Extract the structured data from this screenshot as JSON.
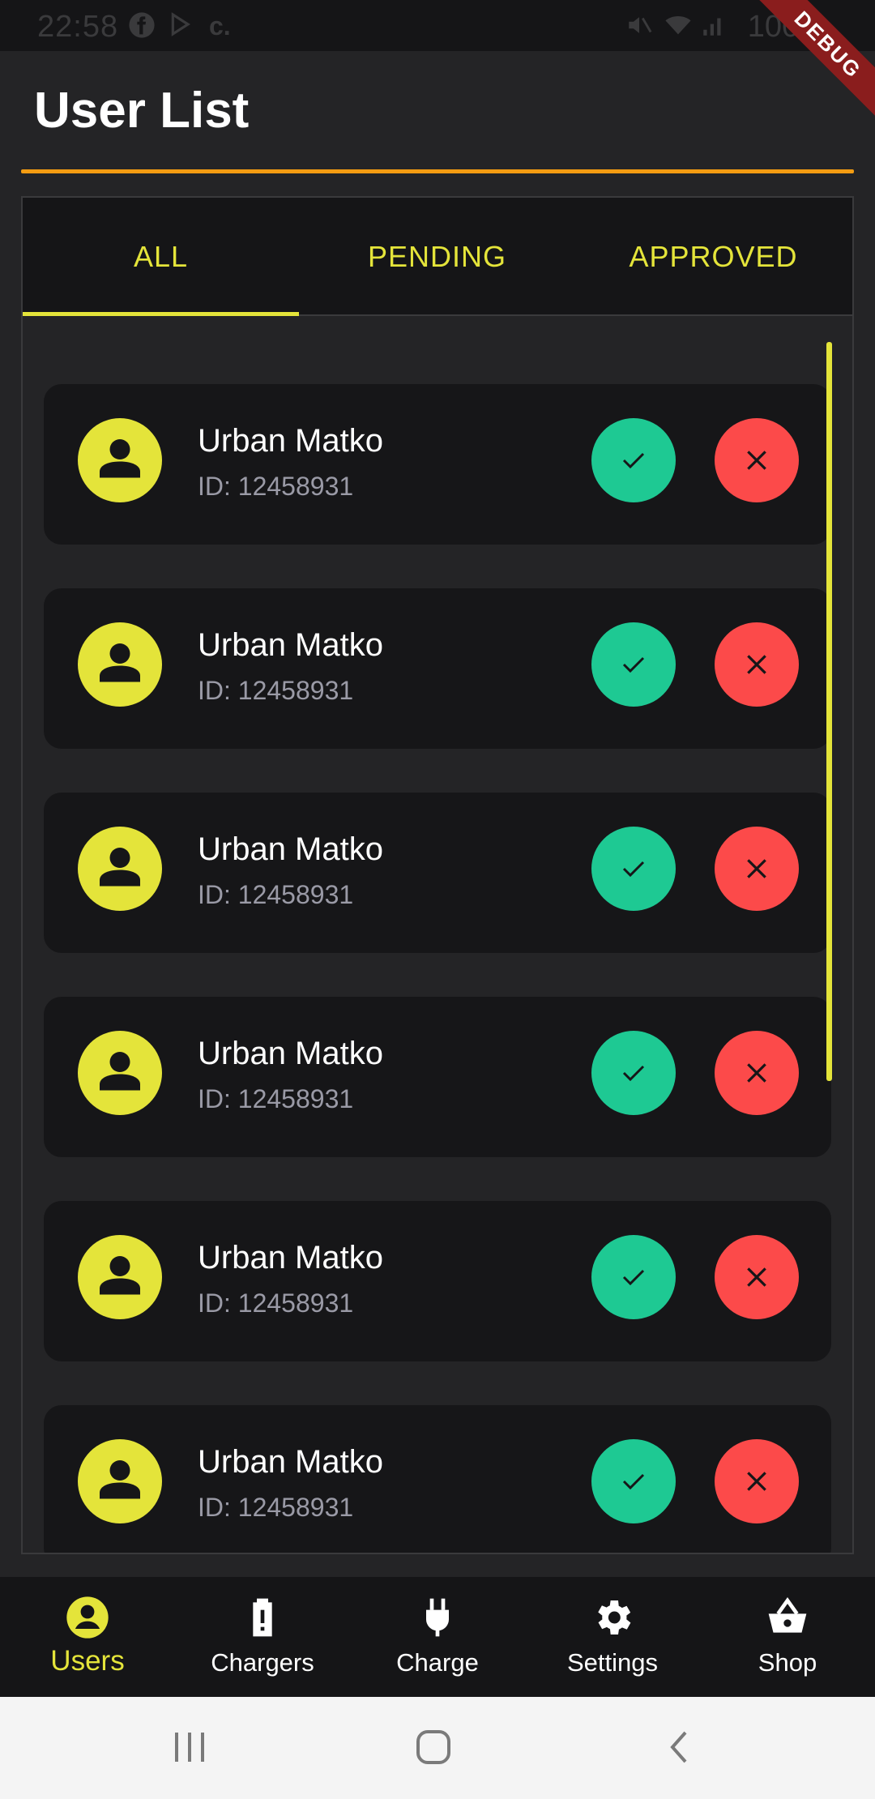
{
  "status_bar": {
    "time": "22:58",
    "battery": "100%",
    "icons": [
      "facebook-icon",
      "play-store-icon",
      "c-icon",
      "mute-icon",
      "wifi-icon",
      "signal-icon",
      "battery-icon"
    ]
  },
  "debug_banner": "DEBUG",
  "app_bar": {
    "title": "User List",
    "accent_color": "#f39c12"
  },
  "tabs": [
    {
      "label": "ALL",
      "active": true
    },
    {
      "label": "PENDING",
      "active": false
    },
    {
      "label": "APPROVED",
      "active": false
    }
  ],
  "users": [
    {
      "name": "Urban Matko",
      "id": "ID: 12458931"
    },
    {
      "name": "Urban Matko",
      "id": "ID: 12458931"
    },
    {
      "name": "Urban Matko",
      "id": "ID: 12458931"
    },
    {
      "name": "Urban Matko",
      "id": "ID: 12458931"
    },
    {
      "name": "Urban Matko",
      "id": "ID: 12458931"
    },
    {
      "name": "Urban Matko",
      "id": "ID: 12458931"
    }
  ],
  "bottom_nav": [
    {
      "label": "Users",
      "icon": "account-circle-icon",
      "active": true
    },
    {
      "label": "Chargers",
      "icon": "battery-alert-icon",
      "active": false
    },
    {
      "label": "Charge",
      "icon": "power-plug-icon",
      "active": false
    },
    {
      "label": "Settings",
      "icon": "gear-icon",
      "active": false
    },
    {
      "label": "Shop",
      "icon": "shopping-basket-icon",
      "active": false
    }
  ],
  "system_nav": [
    "recent-apps-icon",
    "home-icon",
    "back-icon"
  ],
  "colors": {
    "accent_yellow": "#e4e43a",
    "approve_green": "#1ec993",
    "reject_red": "#fc4a4a",
    "background": "#242426",
    "card": "#161618"
  }
}
